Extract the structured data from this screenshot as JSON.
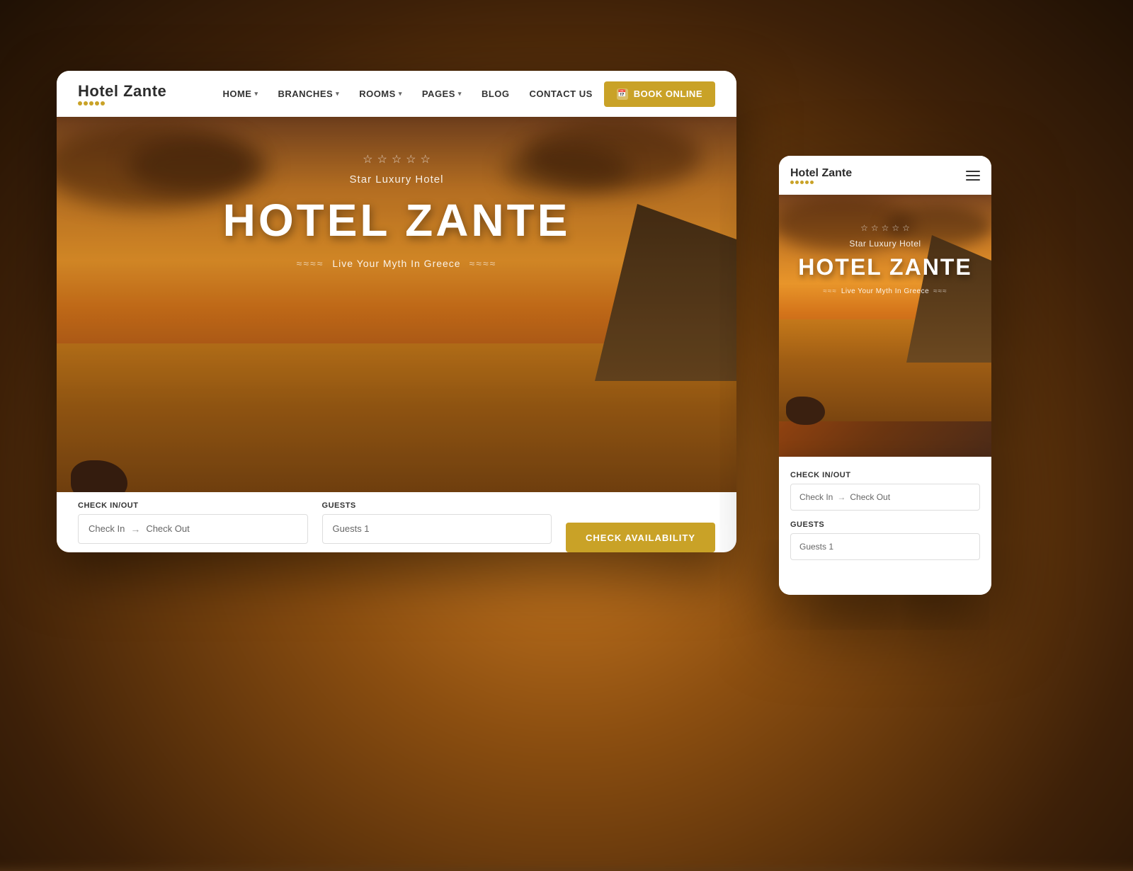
{
  "page": {
    "background_color": "#5a3a1a"
  },
  "desktop": {
    "nav": {
      "logo": {
        "text": "Hotel Zante",
        "star_count": 5
      },
      "links": [
        {
          "label": "HOME",
          "has_dropdown": true
        },
        {
          "label": "BRANCHES",
          "has_dropdown": true
        },
        {
          "label": "ROOMS",
          "has_dropdown": true
        },
        {
          "label": "PAGES",
          "has_dropdown": true
        },
        {
          "label": "BLOG",
          "has_dropdown": false
        },
        {
          "label": "CONTACT US",
          "has_dropdown": false
        }
      ],
      "book_button": "BOOK ONLINE"
    },
    "hero": {
      "star_count": 5,
      "subtitle": "Star Luxury Hotel",
      "title": "HOTEL ZANTE",
      "tagline": "Live Your Myth In Greece",
      "wave_left": "≈≈≈≈",
      "wave_right": "≈≈≈≈"
    },
    "booking_bar": {
      "checkin_label": "Check In/Out",
      "checkin_placeholder": "Check In",
      "checkout_placeholder": "Check Out",
      "guests_label": "Guests",
      "guests_value": "Guests 1",
      "cta_button": "CHECK AVAILABILITY"
    }
  },
  "mobile": {
    "nav": {
      "logo": "Hotel Zante",
      "star_count": 5
    },
    "hero": {
      "star_count": 5,
      "subtitle": "Star Luxury Hotel",
      "title": "HOTEL ZANTE",
      "tagline": "Live Your Myth In Greece",
      "wave_left": "≈≈≈",
      "wave_right": "≈≈≈"
    },
    "booking": {
      "checkin_label": "Check In/Out",
      "checkin_placeholder": "Check In",
      "checkout_placeholder": "Check Out",
      "guests_label": "Guests",
      "guests_value": "Guests 1"
    }
  }
}
